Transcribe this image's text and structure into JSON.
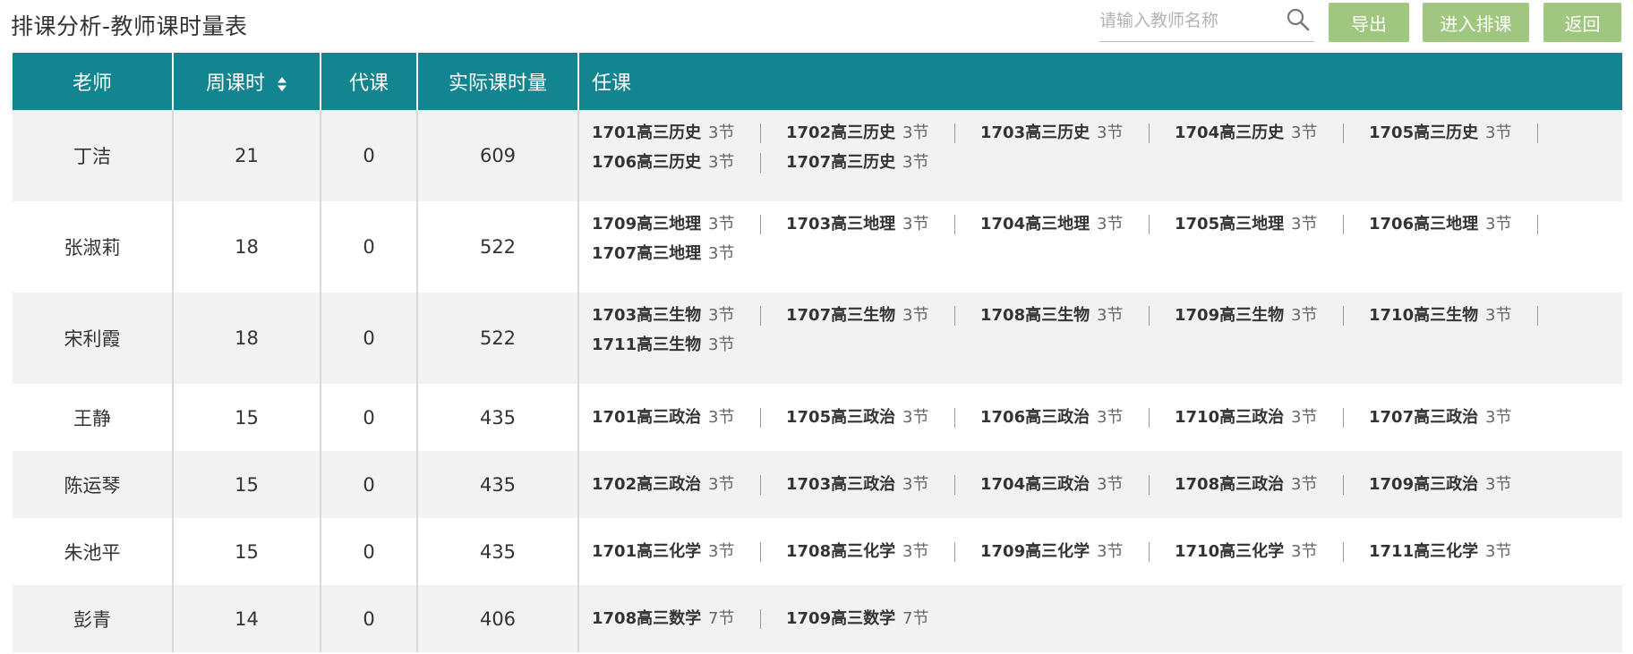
{
  "page": {
    "title": "排课分析-教师课时量表"
  },
  "search": {
    "placeholder": "请输入教师名称",
    "value": "",
    "icon": "search-icon"
  },
  "toolbar": {
    "export_label": "导出",
    "enter_label": "进入排课",
    "back_label": "返回",
    "button_color": "#9fc77f"
  },
  "table": {
    "header_color": "#138590",
    "headers": {
      "teacher": "老师",
      "weekly": "周课时",
      "substitute": "代课",
      "actual": "实际课时量",
      "assignments": "任课"
    },
    "rows": [
      {
        "teacher": "丁洁",
        "weekly": "21",
        "substitute": "0",
        "actual": "609",
        "assignments": [
          {
            "class": "1701高三历史",
            "count": "3节"
          },
          {
            "class": "1702高三历史",
            "count": "3节"
          },
          {
            "class": "1703高三历史",
            "count": "3节"
          },
          {
            "class": "1704高三历史",
            "count": "3节"
          },
          {
            "class": "1705高三历史",
            "count": "3节"
          },
          {
            "class": "1706高三历史",
            "count": "3节"
          },
          {
            "class": "1707高三历史",
            "count": "3节"
          }
        ]
      },
      {
        "teacher": "张淑莉",
        "weekly": "18",
        "substitute": "0",
        "actual": "522",
        "assignments": [
          {
            "class": "1709高三地理",
            "count": "3节"
          },
          {
            "class": "1703高三地理",
            "count": "3节"
          },
          {
            "class": "1704高三地理",
            "count": "3节"
          },
          {
            "class": "1705高三地理",
            "count": "3节"
          },
          {
            "class": "1706高三地理",
            "count": "3节"
          },
          {
            "class": "1707高三地理",
            "count": "3节"
          }
        ]
      },
      {
        "teacher": "宋利霞",
        "weekly": "18",
        "substitute": "0",
        "actual": "522",
        "assignments": [
          {
            "class": "1703高三生物",
            "count": "3节"
          },
          {
            "class": "1707高三生物",
            "count": "3节"
          },
          {
            "class": "1708高三生物",
            "count": "3节"
          },
          {
            "class": "1709高三生物",
            "count": "3节"
          },
          {
            "class": "1710高三生物",
            "count": "3节"
          },
          {
            "class": "1711高三生物",
            "count": "3节"
          }
        ]
      },
      {
        "teacher": "王静",
        "weekly": "15",
        "substitute": "0",
        "actual": "435",
        "assignments": [
          {
            "class": "1701高三政治",
            "count": "3节"
          },
          {
            "class": "1705高三政治",
            "count": "3节"
          },
          {
            "class": "1706高三政治",
            "count": "3节"
          },
          {
            "class": "1710高三政治",
            "count": "3节"
          },
          {
            "class": "1707高三政治",
            "count": "3节"
          }
        ]
      },
      {
        "teacher": "陈运琴",
        "weekly": "15",
        "substitute": "0",
        "actual": "435",
        "assignments": [
          {
            "class": "1702高三政治",
            "count": "3节"
          },
          {
            "class": "1703高三政治",
            "count": "3节"
          },
          {
            "class": "1704高三政治",
            "count": "3节"
          },
          {
            "class": "1708高三政治",
            "count": "3节"
          },
          {
            "class": "1709高三政治",
            "count": "3节"
          }
        ]
      },
      {
        "teacher": "朱池平",
        "weekly": "15",
        "substitute": "0",
        "actual": "435",
        "assignments": [
          {
            "class": "1701高三化学",
            "count": "3节"
          },
          {
            "class": "1708高三化学",
            "count": "3节"
          },
          {
            "class": "1709高三化学",
            "count": "3节"
          },
          {
            "class": "1710高三化学",
            "count": "3节"
          },
          {
            "class": "1711高三化学",
            "count": "3节"
          }
        ]
      },
      {
        "teacher": "彭青",
        "weekly": "14",
        "substitute": "0",
        "actual": "406",
        "assignments": [
          {
            "class": "1708高三数学",
            "count": "7节"
          },
          {
            "class": "1709高三数学",
            "count": "7节"
          }
        ]
      }
    ]
  }
}
